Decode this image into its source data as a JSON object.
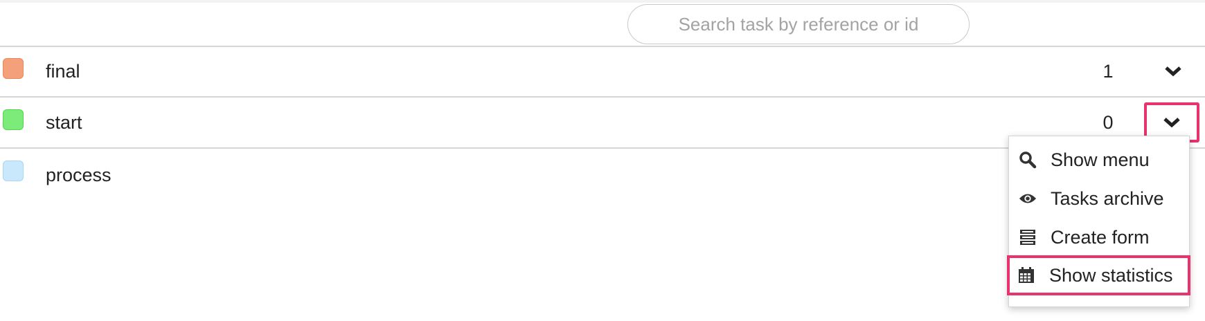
{
  "search": {
    "placeholder": "Search task by reference or id"
  },
  "rows": [
    {
      "label": "final",
      "count": "1",
      "color": "#f4a07a",
      "border": "#e8885c"
    },
    {
      "label": "start",
      "count": "0",
      "color": "#7deb7a",
      "border": "#55d452"
    },
    {
      "label": "process",
      "count": "",
      "color": "#c9e8fb",
      "border": "#a9d6f2"
    }
  ],
  "menu": {
    "items": [
      {
        "label": "Show menu",
        "icon": "search-icon"
      },
      {
        "label": "Tasks archive",
        "icon": "eye-icon"
      },
      {
        "label": "Create form",
        "icon": "form-icon"
      },
      {
        "label": "Show statistics",
        "icon": "calendar-icon"
      }
    ]
  },
  "colors": {
    "highlight": "#e8336d",
    "divider": "#d6d6d6"
  }
}
